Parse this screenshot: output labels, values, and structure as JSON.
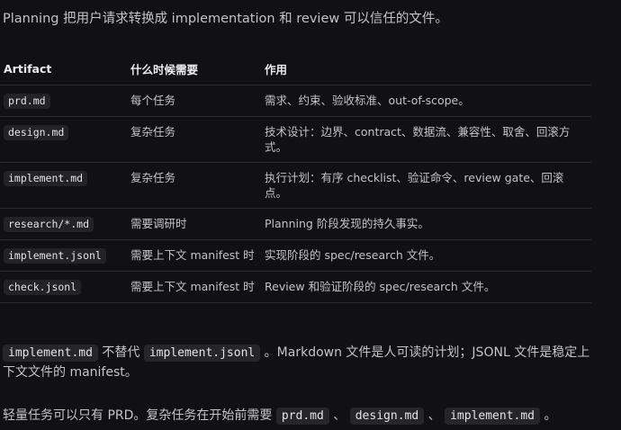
{
  "intro": "Planning 把用户请求转换成 implementation 和 review 可以信任的文件。",
  "table": {
    "headers": [
      "Artifact",
      "什么时候需要",
      "作用"
    ],
    "rows": [
      {
        "artifact": "prd.md",
        "when": "每个任务",
        "purpose": "需求、约束、验收标准、out-of-scope。"
      },
      {
        "artifact": "design.md",
        "when": "复杂任务",
        "purpose": "技术设计：边界、contract、数据流、兼容性、取舍、回滚方式。"
      },
      {
        "artifact": "implement.md",
        "when": "复杂任务",
        "purpose": "执行计划：有序 checklist、验证命令、review gate、回滚点。"
      },
      {
        "artifact": "research/*.md",
        "when": "需要调研时",
        "purpose": "Planning 阶段发现的持久事实。"
      },
      {
        "artifact": "implement.jsonl",
        "when": "需要上下文 manifest 时",
        "purpose": "实现阶段的 spec/research 文件。"
      },
      {
        "artifact": "check.jsonl",
        "when": "需要上下文 manifest 时",
        "purpose": "Review 和验证阶段的 spec/research 文件。"
      }
    ]
  },
  "note": {
    "code1": "implement.md",
    "text1": " 不替代 ",
    "code2": "implement.jsonl",
    "text2": " 。Markdown 文件是人可读的计划；JSONL 文件是稳定上下文文件的 manifest。"
  },
  "light": {
    "text1": "轻量任务可以只有 PRD。复杂任务在开始前需要 ",
    "code1": "prd.md",
    "sep1": " 、 ",
    "code2": "design.md",
    "sep2": " 、 ",
    "code3": "implement.md",
    "end": " 。"
  }
}
